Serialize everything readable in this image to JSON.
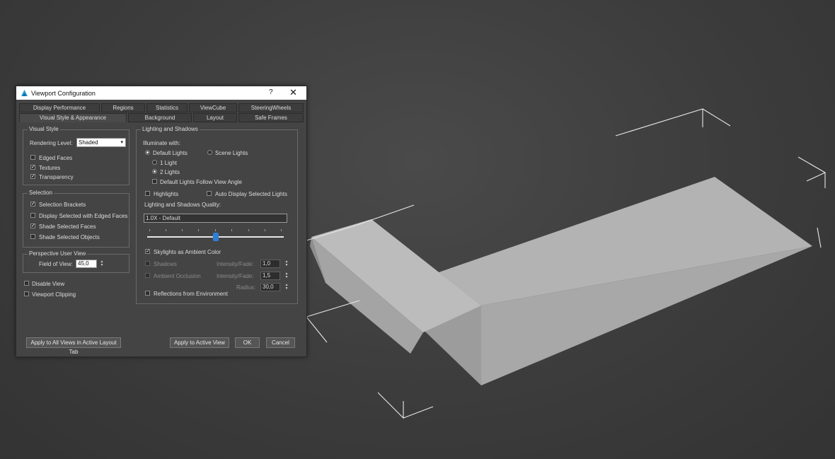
{
  "dialog": {
    "title": "Viewport Configuration",
    "help_label": "?",
    "close_label": "✕"
  },
  "tabs_row1": [
    "Display Performance",
    "Regions",
    "Statistics",
    "ViewCube",
    "SteeringWheels"
  ],
  "tabs_row2": [
    "Visual Style & Appearance",
    "Background",
    "Layout",
    "Safe Frames"
  ],
  "active_tab": "Visual Style & Appearance",
  "visual_style": {
    "group_label": "Visual Style",
    "rendering_level_label": "Rendering Level:",
    "rendering_level_value": "Shaded",
    "edged_faces": {
      "label": "Edged Faces",
      "checked": false
    },
    "textures": {
      "label": "Textures",
      "checked": true
    },
    "transparency": {
      "label": "Transparency",
      "checked": true
    }
  },
  "selection": {
    "group_label": "Selection",
    "selection_brackets": {
      "label": "Selection Brackets",
      "checked": true
    },
    "display_selected_edged": {
      "label": "Display Selected with Edged Faces",
      "checked": false
    },
    "shade_selected_faces": {
      "label": "Shade Selected Faces",
      "checked": true
    },
    "shade_selected_objects": {
      "label": "Shade Selected Objects",
      "checked": false
    }
  },
  "perspective": {
    "group_label": "Perspective User View",
    "fov_label": "Field of View:",
    "fov_value": "45,0"
  },
  "disable_view": {
    "label": "Disable View",
    "checked": false
  },
  "viewport_clipping": {
    "label": "Viewport Clipping",
    "checked": false
  },
  "lighting": {
    "group_label": "Lighting and Shadows",
    "illuminate_label": "Illuminate with:",
    "default_lights_label": "Default Lights",
    "scene_lights_label": "Scene Lights",
    "one_light_label": "1 Light",
    "two_lights_label": "2 Lights",
    "follow_view_label": "Default Lights Follow View Angle",
    "highlights_label": "Highlights",
    "auto_display_label": "Auto Display Selected Lights",
    "quality_label": "Lighting and Shadows Quality:",
    "quality_value": "1.0X - Default",
    "quality_slider": 0.5,
    "skylights_label": "Skylights as Ambient Color",
    "skylights_checked": true,
    "shadows_label": "Shadows",
    "ambient_occlusion_label": "Ambient Occlusion",
    "intensity_fade_label_1": "Intensity/Fade:",
    "intensity_fade_value_1": "1,0",
    "intensity_fade_label_2": "Intensity/Fade:",
    "intensity_fade_value_2": "1,5",
    "radius_label": "Radius:",
    "radius_value": "30,0",
    "reflections_label": "Reflections from Environment"
  },
  "buttons": {
    "apply_all": "Apply to All Views in Active Layout Tab",
    "apply_active": "Apply to Active View",
    "ok": "OK",
    "cancel": "Cancel"
  },
  "colors": {
    "viewport_bg": "#3c3c3c",
    "dialog_bg": "#444444",
    "accent": "#2d7fd6",
    "model_face": "#b4b4b4"
  },
  "icons": {
    "app": "3dsmax-logo-icon",
    "close": "close-icon",
    "help": "help-icon"
  }
}
